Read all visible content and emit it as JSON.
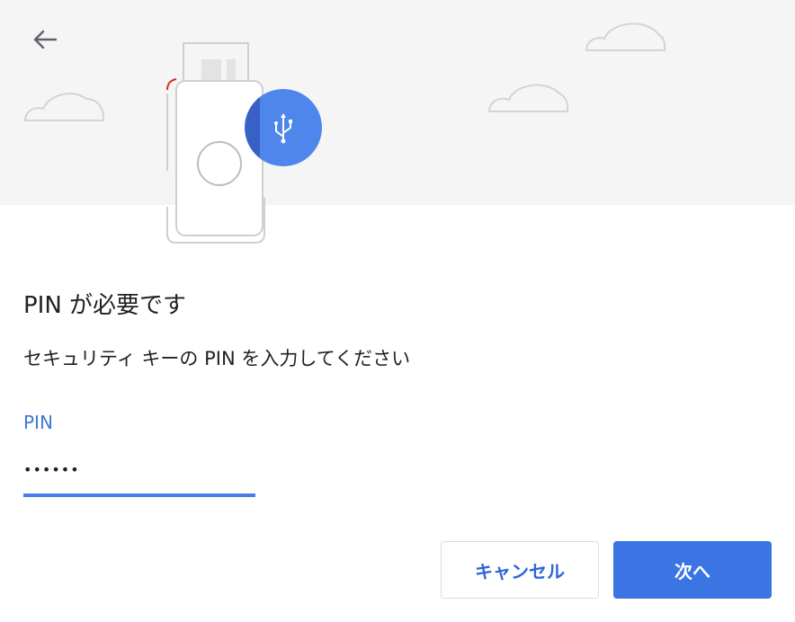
{
  "dialog": {
    "title": "PIN が必要です",
    "description": "セキュリティ キーの PIN を入力してください"
  },
  "pin_field": {
    "label": "PIN",
    "value": "••••••"
  },
  "buttons": {
    "cancel": "キャンセル",
    "next": "次へ"
  },
  "icons": {
    "back": "arrow-left-icon",
    "usb": "usb-icon",
    "security_key": "security-key-illustration",
    "cloud": "cloud-icon"
  },
  "colors": {
    "accent": "#3b74e3",
    "label_blue": "#3c78d8",
    "header_bg": "#f5f5f5",
    "usb_badge": "#4f86ec",
    "usb_badge_dark": "#3960c4"
  }
}
